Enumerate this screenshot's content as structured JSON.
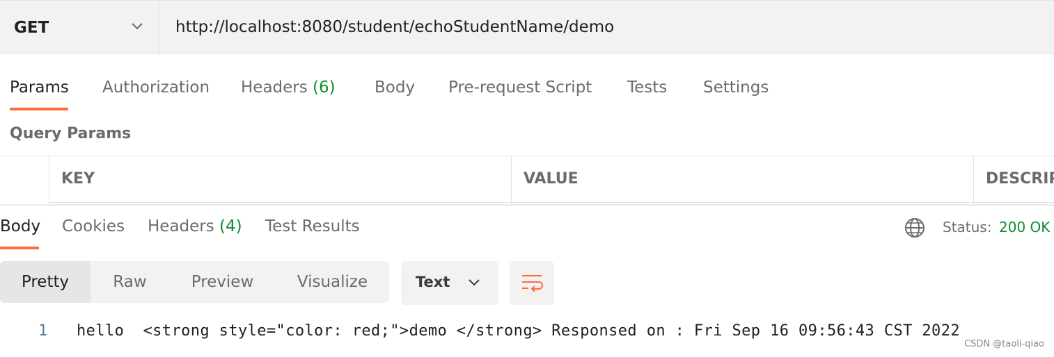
{
  "request": {
    "method": "GET",
    "url": "http://localhost:8080/student/echoStudentName/demo"
  },
  "request_tabs": {
    "params": "Params",
    "authorization": "Authorization",
    "headers": "Headers",
    "headers_count": "(6)",
    "body": "Body",
    "prerequest": "Pre-request Script",
    "tests": "Tests",
    "settings": "Settings"
  },
  "query_params": {
    "title": "Query Params",
    "columns": [
      "KEY",
      "VALUE",
      "DESCRIP"
    ]
  },
  "response_tabs": {
    "body": "Body",
    "cookies": "Cookies",
    "headers": "Headers",
    "headers_count": "(4)",
    "test_results": "Test Results"
  },
  "status": {
    "label": "Status:",
    "value": "200 OK"
  },
  "view_modes": [
    "Pretty",
    "Raw",
    "Preview",
    "Visualize"
  ],
  "format": "Text",
  "response_body": {
    "line_number": "1",
    "content": "hello  <strong style=\"color: red;\">demo </strong> Responsed on : Fri Sep 16 09:56:43 CST 2022"
  },
  "watermark": "CSDN @taoli-qiao",
  "colors": {
    "accent": "#ff6c37",
    "success": "#0f8a2e",
    "line_number": "#4e7ea6"
  },
  "icons": {
    "method_dropdown": "chevron-down-icon",
    "format_dropdown": "chevron-down-icon",
    "environment": "globe-icon",
    "wrap": "wrap-lines-icon"
  }
}
